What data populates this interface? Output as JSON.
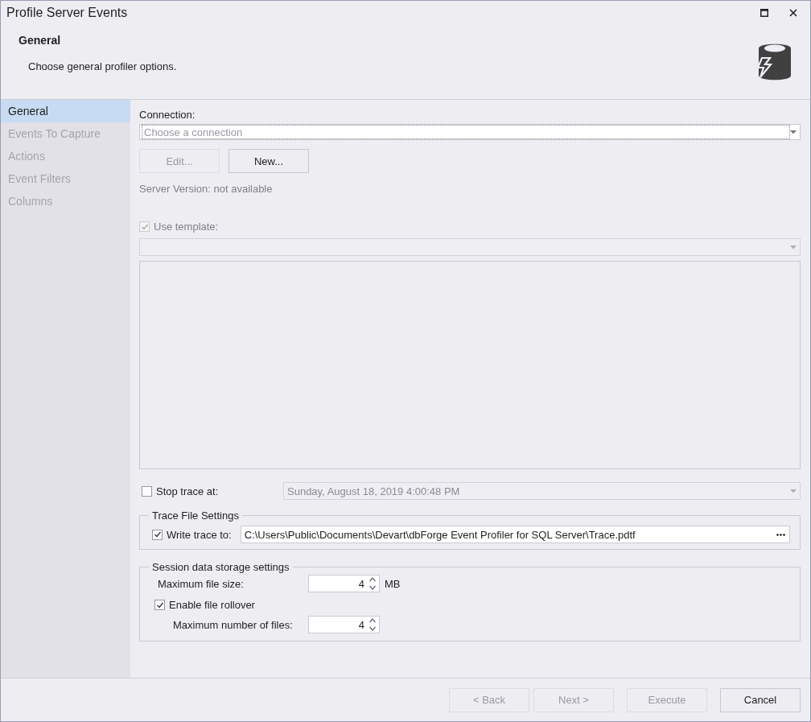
{
  "window": {
    "title": "Profile Server Events"
  },
  "header": {
    "title": "General",
    "subtitle": "Choose general profiler options."
  },
  "sidebar": {
    "items": [
      {
        "label": "General",
        "selected": true,
        "disabled": false
      },
      {
        "label": "Events To Capture",
        "selected": false,
        "disabled": true
      },
      {
        "label": "Actions",
        "selected": false,
        "disabled": true
      },
      {
        "label": "Event Filters",
        "selected": false,
        "disabled": true
      },
      {
        "label": "Columns",
        "selected": false,
        "disabled": true
      }
    ]
  },
  "connection": {
    "label": "Connection:",
    "placeholder": "Choose a connection"
  },
  "connection_buttons": [
    {
      "label": "Edit...",
      "disabled": true
    },
    {
      "label": "New...",
      "disabled": false
    }
  ],
  "server_version": "Server Version: not available",
  "use_template": {
    "label": "Use template:",
    "checked": true,
    "disabled": true
  },
  "stop_trace": {
    "label": "Stop trace at:",
    "checked": false,
    "value": "Sunday, August 18, 2019 4:00:48 PM"
  },
  "trace_file_settings": {
    "title": "Trace File Settings",
    "write_trace": {
      "label": "Write trace to:",
      "checked": true,
      "value": "C:\\Users\\Public\\Documents\\Devart\\dbForge Event Profiler for SQL Server\\Trace.pdtf"
    }
  },
  "session_storage": {
    "title": "Session data storage settings",
    "max_file_size": {
      "label": "Maximum file size:",
      "value": "4",
      "unit": "MB"
    },
    "rollover": {
      "label": "Enable file rollover",
      "checked": true
    },
    "max_files": {
      "label": "Maximum number of files:",
      "value": "4"
    }
  },
  "footer_buttons": [
    {
      "label": "< Back",
      "disabled": true
    },
    {
      "label": "Next >",
      "disabled": true
    },
    {
      "label": "Execute",
      "disabled": true
    },
    {
      "label": "Cancel",
      "disabled": false
    }
  ]
}
